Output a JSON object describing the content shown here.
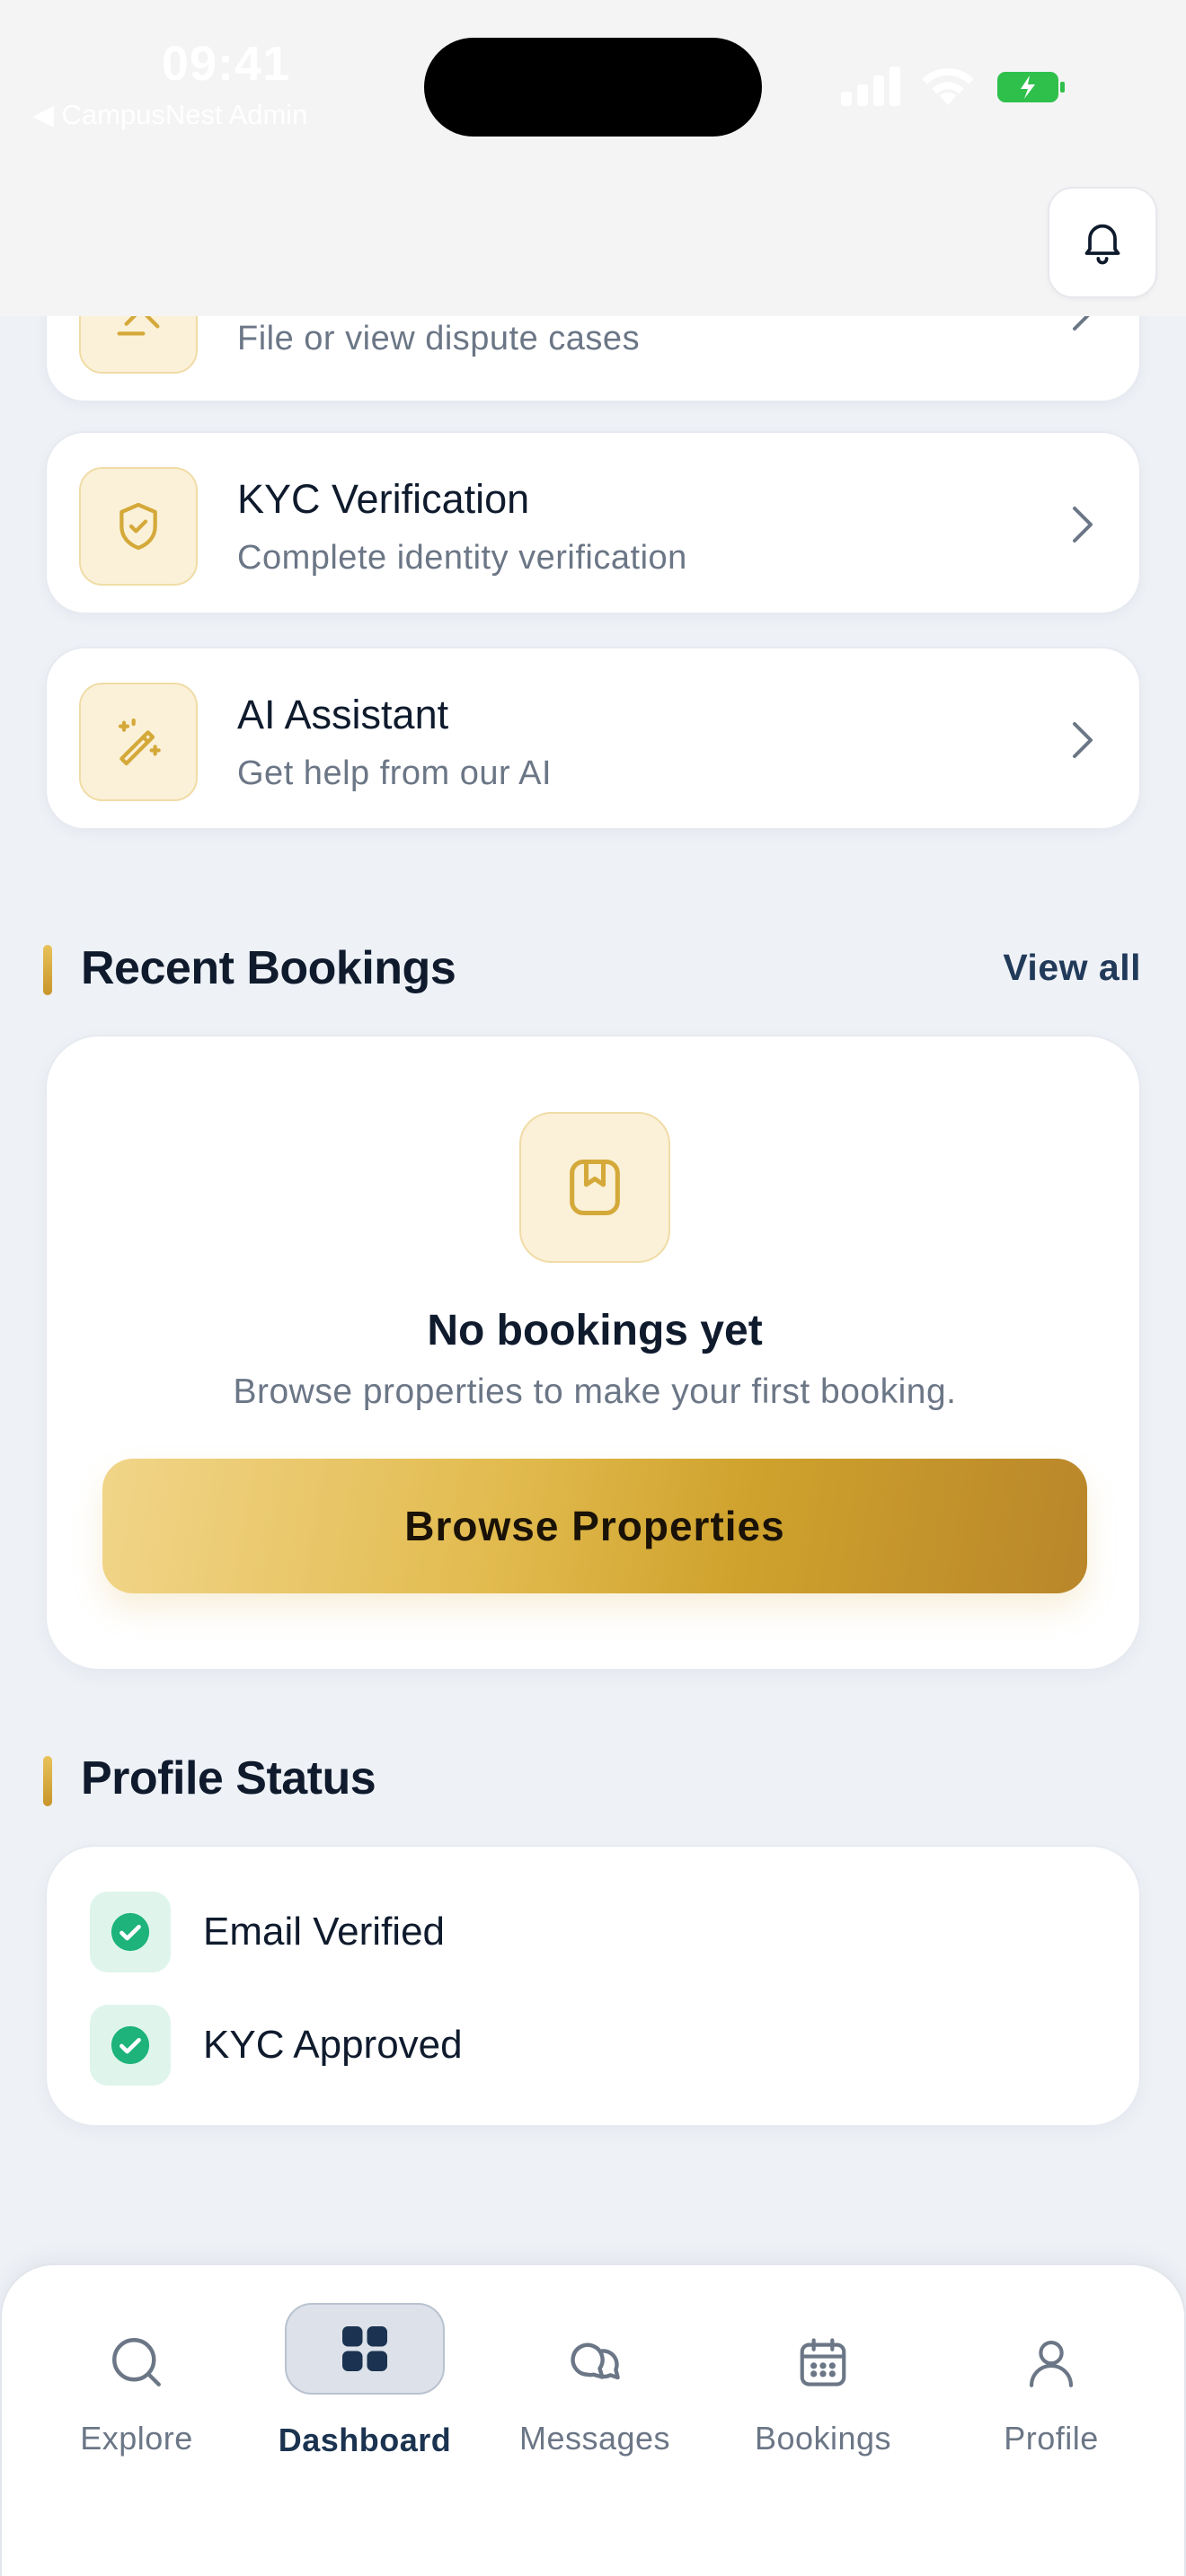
{
  "status_bar": {
    "time": "09:41",
    "back_label": "◀ CampusNest Admin",
    "icons": [
      "signal-icon",
      "wifi-icon",
      "battery-icon"
    ]
  },
  "header": {
    "notification_icon": "bell-icon"
  },
  "menu": {
    "items": [
      {
        "title": "",
        "subtitle": "File or view dispute cases",
        "icon": "gavel-icon"
      },
      {
        "title": "KYC Verification",
        "subtitle": "Complete identity verification",
        "icon": "shield-check-icon"
      },
      {
        "title": "AI Assistant",
        "subtitle": "Get help from our AI",
        "icon": "magic-wand-icon"
      }
    ]
  },
  "recent_bookings": {
    "title": "Recent Bookings",
    "view_all": "View all",
    "empty_icon": "bookmark-icon",
    "empty_title": "No bookings yet",
    "empty_subtitle": "Browse properties to make your first booking.",
    "browse_button": "Browse Properties"
  },
  "profile_status": {
    "title": "Profile Status",
    "items": [
      {
        "label": "Email Verified",
        "icon": "check-circle-icon"
      },
      {
        "label": "KYC Approved",
        "icon": "check-circle-icon"
      }
    ]
  },
  "bottom_nav": {
    "items": [
      {
        "label": "Explore",
        "icon": "search-icon"
      },
      {
        "label": "Dashboard",
        "icon": "grid-icon",
        "active": true
      },
      {
        "label": "Messages",
        "icon": "chat-icon"
      },
      {
        "label": "Bookings",
        "icon": "calendar-icon"
      },
      {
        "label": "Profile",
        "icon": "user-icon"
      }
    ]
  },
  "colors": {
    "accent_gold": "#d4a93a",
    "navy": "#1b3350",
    "success_green": "#1db37a",
    "background": "#eef1f6"
  }
}
